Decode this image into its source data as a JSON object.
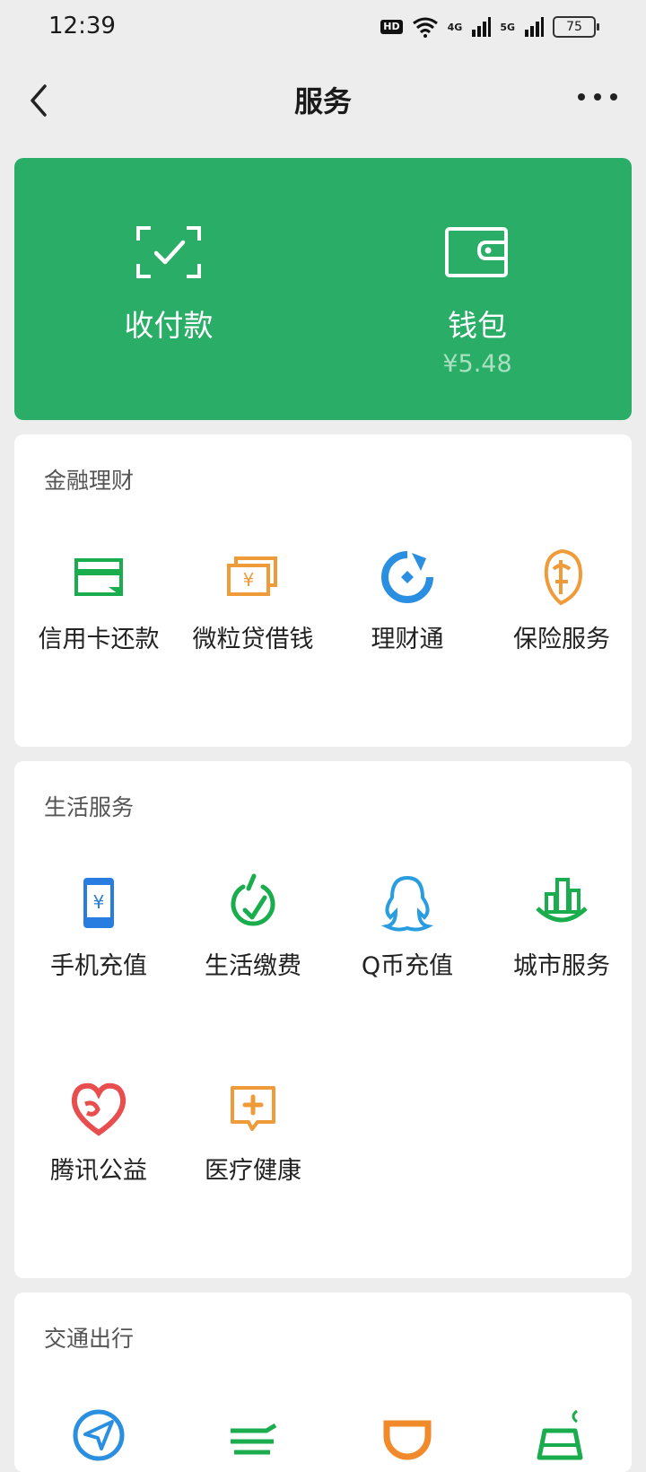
{
  "status": {
    "time": "12:39",
    "hd": "HD",
    "net1": "4G",
    "net2": "5G",
    "battery": "75"
  },
  "nav": {
    "title": "服务"
  },
  "wallet_card": {
    "pay": {
      "label": "收付款"
    },
    "wallet": {
      "label": "钱包",
      "balance": "¥5.48"
    }
  },
  "finance": {
    "title": "金融理财",
    "items": [
      {
        "label": "信用卡还款",
        "icon": "credit-card-icon",
        "color": "#1aad4d"
      },
      {
        "label": "微粒贷借钱",
        "icon": "loan-icon",
        "color": "#f09b3a"
      },
      {
        "label": "理财通",
        "icon": "licaitong-icon",
        "color": "#2a8fe0"
      },
      {
        "label": "保险服务",
        "icon": "insurance-icon",
        "color": "#f09b3a"
      }
    ]
  },
  "life": {
    "title": "生活服务",
    "items": [
      {
        "label": "手机充值",
        "icon": "phone-recharge-icon",
        "color": "#2a7de0"
      },
      {
        "label": "生活缴费",
        "icon": "utility-bill-icon",
        "color": "#1aad4d"
      },
      {
        "label": "Q币充值",
        "icon": "qq-penguin-icon",
        "color": "#2a9de0"
      },
      {
        "label": "城市服务",
        "icon": "city-service-icon",
        "color": "#1aad4d"
      },
      {
        "label": "腾讯公益",
        "icon": "charity-heart-icon",
        "color": "#e84e4e"
      },
      {
        "label": "医疗健康",
        "icon": "medical-icon",
        "color": "#f09b3a"
      }
    ]
  },
  "transport": {
    "title": "交通出行"
  }
}
